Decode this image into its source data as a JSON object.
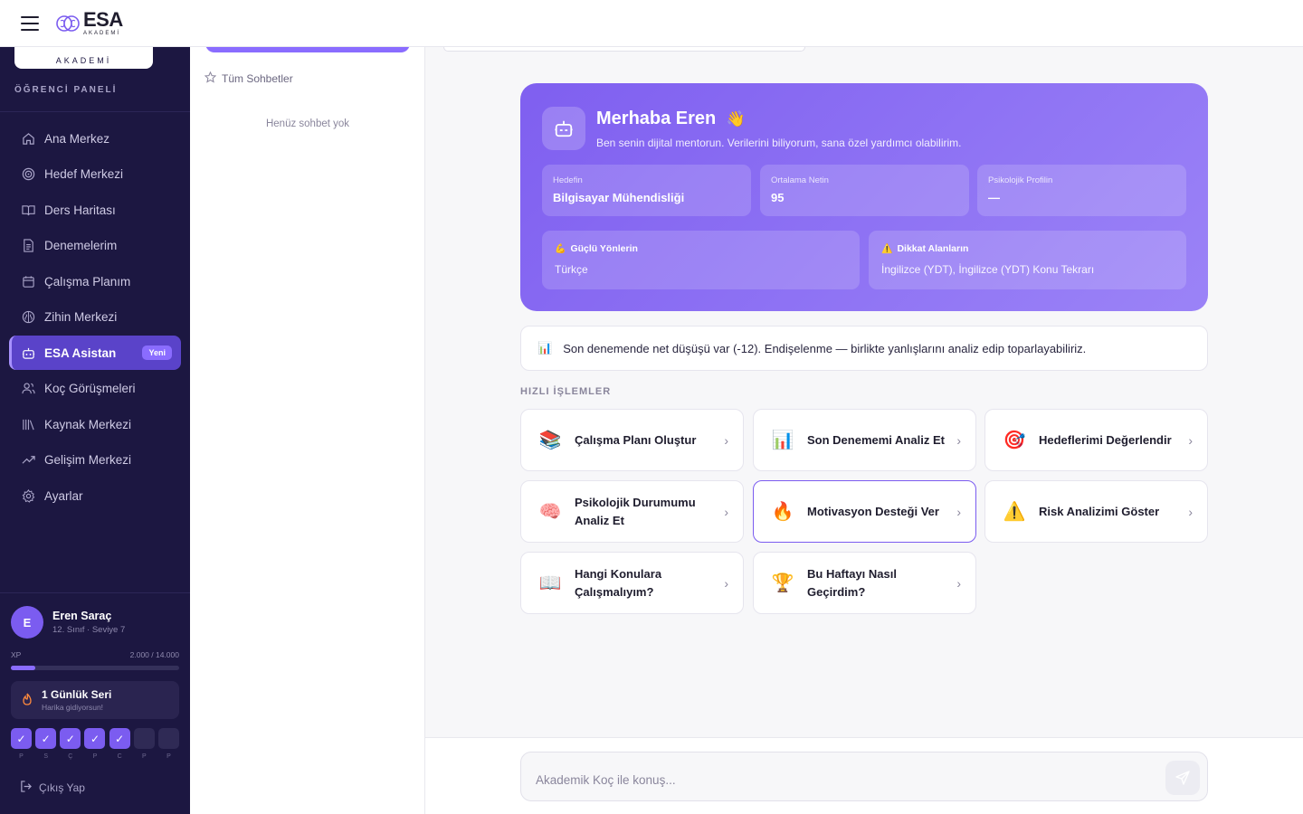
{
  "topbar": {
    "logo_main": "ESA",
    "logo_sub": "AKADEMİ"
  },
  "sidebar": {
    "logo_sub": "AKADEMİ",
    "section_title": "ÖĞRENCİ PANELİ",
    "items": [
      {
        "label": "Ana Merkez",
        "icon": "home-icon"
      },
      {
        "label": "Hedef Merkezi",
        "icon": "target-icon"
      },
      {
        "label": "Ders Haritası",
        "icon": "book-open-icon"
      },
      {
        "label": "Denemelerim",
        "icon": "document-icon"
      },
      {
        "label": "Çalışma Planım",
        "icon": "calendar-icon"
      },
      {
        "label": "Zihin Merkezi",
        "icon": "brain-icon"
      },
      {
        "label": "ESA Asistan",
        "icon": "bot-icon",
        "active": true,
        "badge": "Yeni"
      },
      {
        "label": "Koç Görüşmeleri",
        "icon": "users-icon"
      },
      {
        "label": "Kaynak Merkezi",
        "icon": "library-icon"
      },
      {
        "label": "Gelişim Merkezi",
        "icon": "trend-icon"
      },
      {
        "label": "Ayarlar",
        "icon": "gear-icon"
      }
    ],
    "user": {
      "initial": "E",
      "name": "Eren Saraç",
      "sub": "12. Sınıf · Seviye 7"
    },
    "xp": {
      "label": "XP",
      "value_text": "2.000 / 14.000",
      "progress": 0.143
    },
    "streak": {
      "title": "1 Günlük Seri",
      "sub": "Harika gidiyorsun!"
    },
    "days": [
      {
        "label": "P",
        "done": true
      },
      {
        "label": "S",
        "done": true
      },
      {
        "label": "Ç",
        "done": true
      },
      {
        "label": "P",
        "done": true
      },
      {
        "label": "C",
        "done": true
      },
      {
        "label": "P",
        "done": false
      },
      {
        "label": "P",
        "done": false
      }
    ],
    "check_mark": "✓",
    "logout": "Çıkış Yap"
  },
  "chatlist": {
    "all_chats": "Tüm Sohbetler",
    "empty": "Henüz sohbet yok"
  },
  "hero": {
    "title": "Merhaba Eren",
    "wave": "👋",
    "subtitle": "Ben senin dijital mentorun. Verilerini biliyorum, sana özel yardımcı olabilirim.",
    "stats": [
      {
        "label": "Hedefin",
        "value": "Bilgisayar Mühendisliği"
      },
      {
        "label": "Ortalama Netin",
        "value": "95"
      },
      {
        "label": "Psikolojik Profilin",
        "value": "—"
      }
    ],
    "strengths": {
      "emoji": "💪",
      "label": "Güçlü Yönlerin",
      "value": "Türkçe"
    },
    "attention": {
      "emoji": "⚠️",
      "label": "Dikkat Alanların",
      "value": "İngilizce (YDT), İngilizce (YDT) Konu Tekrarı"
    }
  },
  "notice": {
    "emoji": "📊",
    "text": "Son denemende net düşüşü var (-12). Endişelenme — birlikte yanlışlarını analiz edip toparlayabiliriz."
  },
  "quick_actions": {
    "title": "HIZLI İŞLEMLER",
    "items": [
      {
        "emoji": "📚",
        "label": "Çalışma Planı Oluştur"
      },
      {
        "emoji": "📊",
        "label": "Son Denememi Analiz Et"
      },
      {
        "emoji": "🎯",
        "label": "Hedeflerimi Değerlendir"
      },
      {
        "emoji": "🧠",
        "label": "Psikolojik Durumumu Analiz Et"
      },
      {
        "emoji": "🔥",
        "label": "Motivasyon Desteği Ver"
      },
      {
        "emoji": "⚠️",
        "label": "Risk Analizimi Göster"
      },
      {
        "emoji": "📖",
        "label": "Hangi Konulara Çalışmalıyım?"
      },
      {
        "emoji": "🏆",
        "label": "Bu Haftayı Nasıl Geçirdim?"
      }
    ],
    "chevron": "›"
  },
  "composer": {
    "placeholder": "Akademik Koç ile konuş..."
  }
}
